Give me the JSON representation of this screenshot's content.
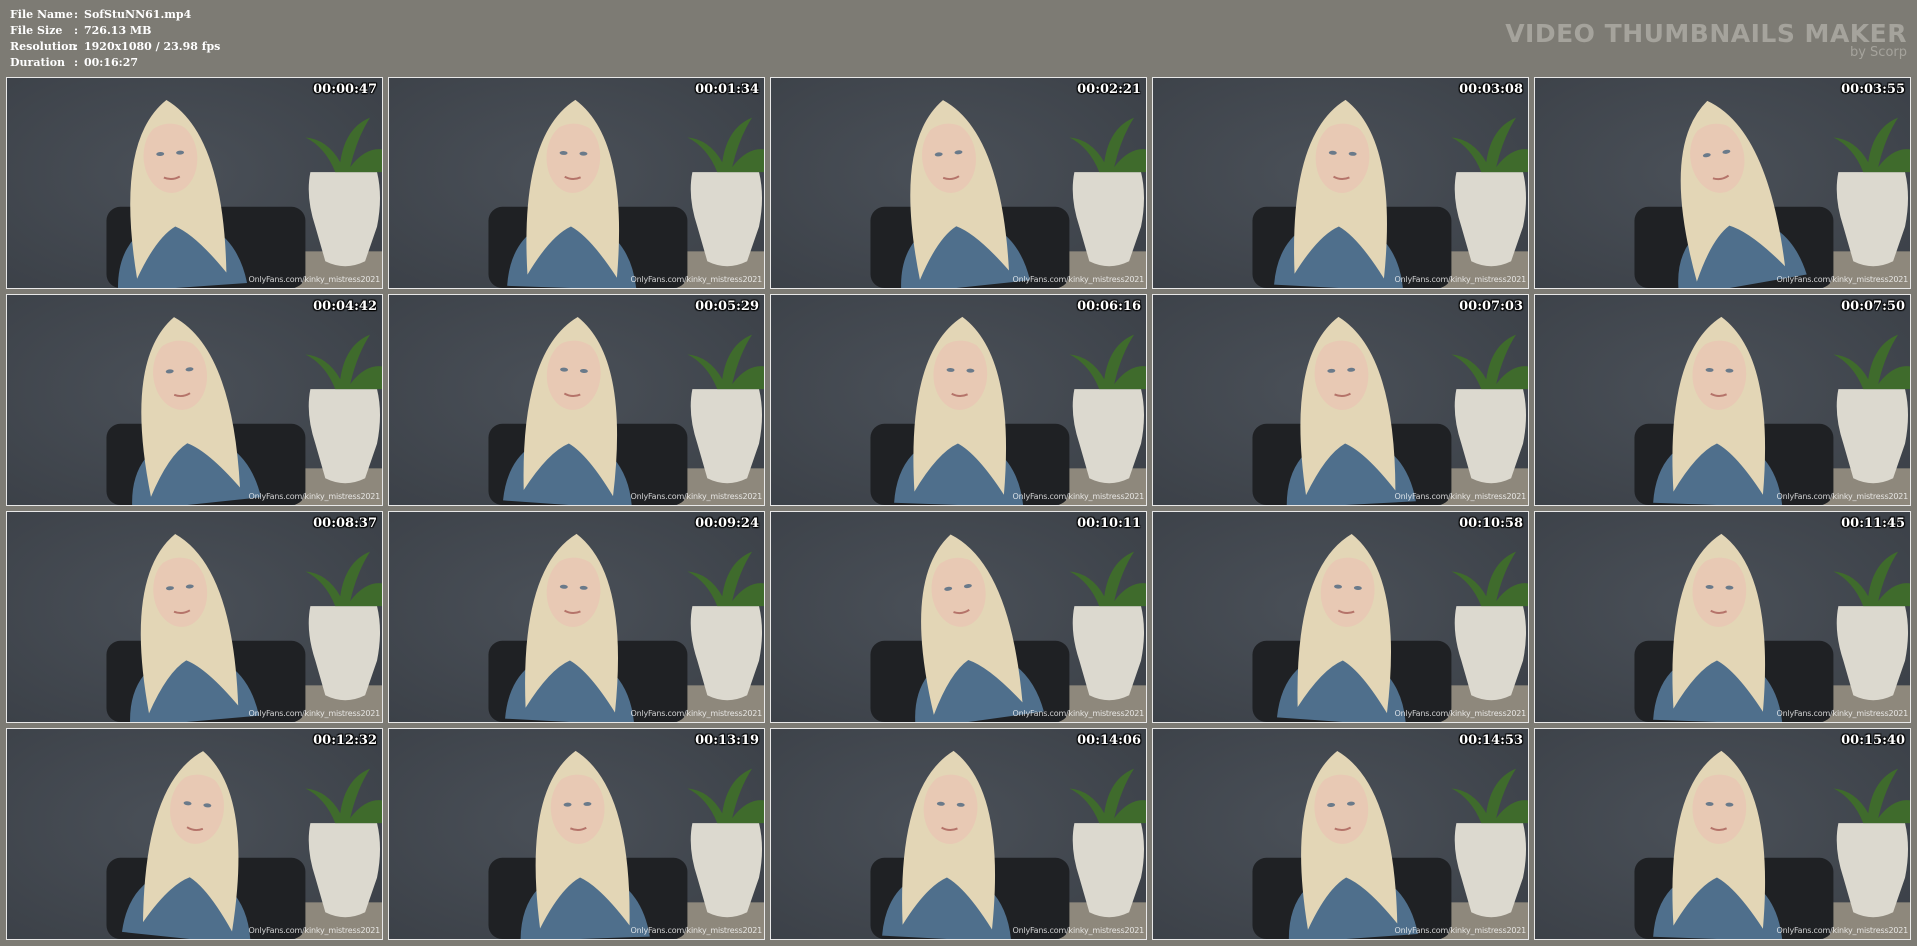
{
  "info": {
    "file_name_label": "File Name",
    "file_name": "SofStuNN61.mp4",
    "file_size_label": "File Size",
    "file_size": "726.13 MB",
    "resolution_label": "Resolution",
    "resolution": "1920x1080 / 23.98 fps",
    "duration_label": "Duration",
    "duration": "00:16:27",
    "separator": ":"
  },
  "brand": {
    "title": "VIDEO THUMBNAILS MAKER",
    "subtitle": "by Scorp"
  },
  "thumbnails": [
    {
      "timestamp": "00:00:47",
      "watermark": "OnlyFans.com/kinky_mistress2021"
    },
    {
      "timestamp": "00:01:34",
      "watermark": "OnlyFans.com/kinky_mistress2021"
    },
    {
      "timestamp": "00:02:21",
      "watermark": "OnlyFans.com/kinky_mistress2021"
    },
    {
      "timestamp": "00:03:08",
      "watermark": "OnlyFans.com/kinky_mistress2021"
    },
    {
      "timestamp": "00:03:55",
      "watermark": "OnlyFans.com/kinky_mistress2021"
    },
    {
      "timestamp": "00:04:42",
      "watermark": "OnlyFans.com/kinky_mistress2021"
    },
    {
      "timestamp": "00:05:29",
      "watermark": "OnlyFans.com/kinky_mistress2021"
    },
    {
      "timestamp": "00:06:16",
      "watermark": "OnlyFans.com/kinky_mistress2021"
    },
    {
      "timestamp": "00:07:03",
      "watermark": "OnlyFans.com/kinky_mistress2021"
    },
    {
      "timestamp": "00:07:50",
      "watermark": "OnlyFans.com/kinky_mistress2021"
    },
    {
      "timestamp": "00:08:37",
      "watermark": "OnlyFans.com/kinky_mistress2021"
    },
    {
      "timestamp": "00:09:24",
      "watermark": "OnlyFans.com/kinky_mistress2021"
    },
    {
      "timestamp": "00:10:11",
      "watermark": "OnlyFans.com/kinky_mistress2021"
    },
    {
      "timestamp": "00:10:58",
      "watermark": "OnlyFans.com/kinky_mistress2021"
    },
    {
      "timestamp": "00:11:45",
      "watermark": "OnlyFans.com/kinky_mistress2021"
    },
    {
      "timestamp": "00:12:32",
      "watermark": "OnlyFans.com/kinky_mistress2021"
    },
    {
      "timestamp": "00:13:19",
      "watermark": "OnlyFans.com/kinky_mistress2021"
    },
    {
      "timestamp": "00:14:06",
      "watermark": "OnlyFans.com/kinky_mistress2021"
    },
    {
      "timestamp": "00:14:53",
      "watermark": "OnlyFans.com/kinky_mistress2021"
    },
    {
      "timestamp": "00:15:40",
      "watermark": "OnlyFans.com/kinky_mistress2021"
    }
  ],
  "colors": {
    "background": "#7d7b74",
    "wall": "#3a3f46",
    "sweater": "#4f6f8c",
    "hair": "#e3d6b6",
    "skin": "#e8c9b4",
    "vase": "#dcd9cf",
    "plant": "#3f6b2c",
    "chair": "#1f2124"
  }
}
